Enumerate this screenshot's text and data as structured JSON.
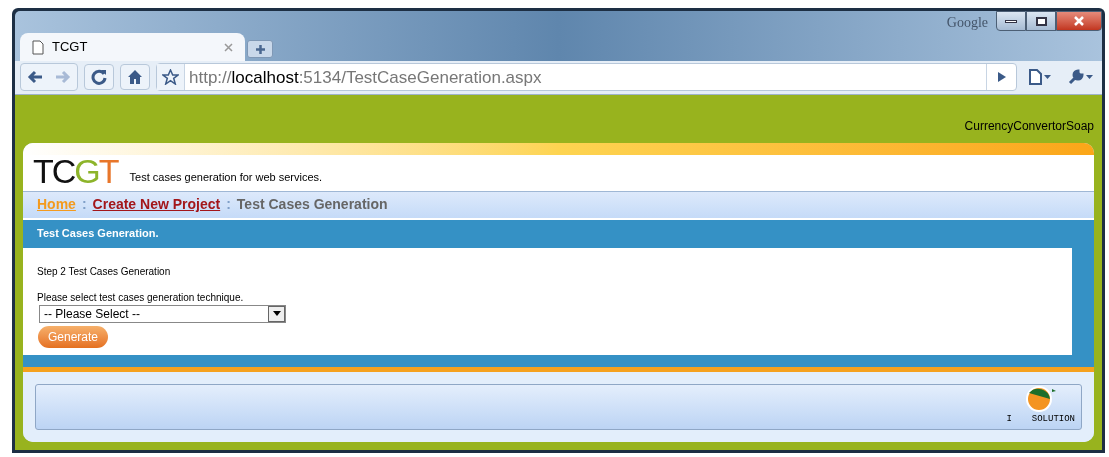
{
  "browser": {
    "search_label": "Google",
    "tab": {
      "title": "TCGT",
      "selected": true
    },
    "address": {
      "scheme": "http://",
      "host": "localhost",
      "path": ":5134/TestCaseGeneration.aspx"
    }
  },
  "page": {
    "service_name": "CurrencyConvertorSoap",
    "logo": {
      "parts": [
        {
          "text": "TC",
          "color": "#111111"
        },
        {
          "text": "G",
          "color": "#8db42a"
        },
        {
          "text": "T",
          "color": "#e8762a"
        }
      ]
    },
    "tagline": "Test cases generation for web services.",
    "breadcrumb": [
      {
        "label": "Home",
        "kind": "link",
        "color": "#f39a1e"
      },
      {
        "separator": ":",
        "label": "Create New Project",
        "kind": "link",
        "color": "#a3161a"
      },
      {
        "separator": ":",
        "label": "Test Cases Generation",
        "kind": "current",
        "color": "#666666"
      }
    ],
    "panel_title": "Test Cases Generation.",
    "step": "Step 2 Test Cases Generation",
    "prompt": "Please select test cases generation technique.",
    "select": {
      "value": "-- Please Select --"
    },
    "button": "Generate",
    "footer_logo": {
      "left": "I",
      "right": "SOLUTION"
    }
  }
}
